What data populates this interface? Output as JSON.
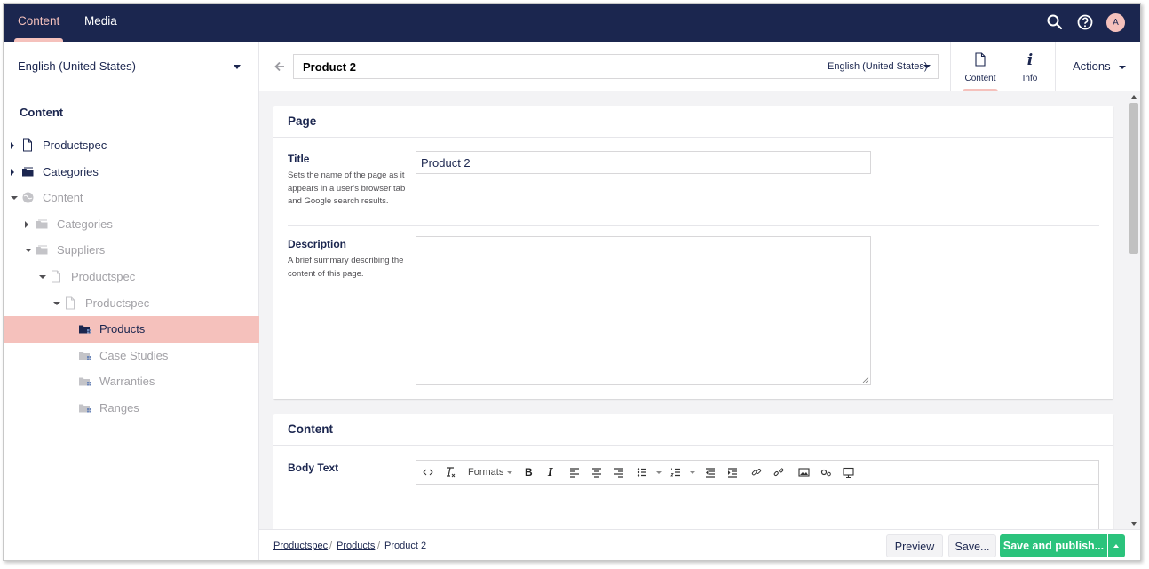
{
  "topbar": {
    "sections": [
      "Content",
      "Media"
    ],
    "active_section": "Content",
    "avatar_initial": "A",
    "icons": [
      "search-icon",
      "help-icon"
    ]
  },
  "sidebar": {
    "language": "English (United States)",
    "tree_title": "Content",
    "tree": [
      {
        "label": "Productspec",
        "toggle": "right",
        "icon": "document-icon",
        "dim": false,
        "selected": false
      },
      {
        "label": "Categories",
        "toggle": "right",
        "icon": "folder-icon",
        "dim": false,
        "selected": false
      },
      {
        "label": "Content",
        "toggle": "down",
        "icon": "globe-icon",
        "dim": true,
        "selected": false
      },
      {
        "label": "Categories",
        "toggle": "right",
        "icon": "folder-icon",
        "dim": true,
        "selected": false
      },
      {
        "label": "Suppliers",
        "toggle": "down",
        "icon": "folder-icon",
        "dim": true,
        "selected": false
      },
      {
        "label": "Productspec",
        "toggle": "down",
        "icon": "document-icon",
        "dim": true,
        "selected": false
      },
      {
        "label": "Productspec",
        "toggle": "down",
        "icon": "document-icon",
        "dim": true,
        "selected": false
      },
      {
        "label": "Products",
        "toggle": "none",
        "icon": "folder-grid-icon",
        "dim": false,
        "selected": true
      },
      {
        "label": "Case Studies",
        "toggle": "none",
        "icon": "folder-grid-icon",
        "dim": true,
        "selected": false
      },
      {
        "label": "Warranties",
        "toggle": "none",
        "icon": "folder-grid-icon",
        "dim": true,
        "selected": false
      },
      {
        "label": "Ranges",
        "toggle": "none",
        "icon": "folder-grid-icon",
        "dim": true,
        "selected": false
      }
    ]
  },
  "editor": {
    "node_name": "Product 2",
    "variant": "English (United States)",
    "apps": [
      {
        "label": "Content",
        "icon": "document-icon",
        "active": true
      },
      {
        "label": "Info",
        "icon": "info-icon",
        "active": false
      }
    ],
    "actions_label": "Actions"
  },
  "page_group": {
    "title": "Page",
    "title_prop": {
      "label": "Title",
      "description": "Sets the name of the page as it appears in a user's browser tab and Google search results.",
      "value": "Product 2"
    },
    "description_prop": {
      "label": "Description",
      "description": "A brief summary describing the content of this page.",
      "value": ""
    }
  },
  "content_group": {
    "title": "Content",
    "body_text_label": "Body Text",
    "toolbar": {
      "formats_label": "Formats",
      "buttons": [
        "source-code-icon",
        "clear-format-icon",
        "bold-icon",
        "italic-icon",
        "align-left-icon",
        "align-center-icon",
        "align-right-icon",
        "bullet-list-icon",
        "numbered-list-icon",
        "outdent-icon",
        "indent-icon",
        "link-icon",
        "unlink-icon",
        "image-icon",
        "macro-icon",
        "embed-icon"
      ]
    }
  },
  "footer": {
    "breadcrumb": [
      "Productspec",
      "Products",
      "Product 2"
    ],
    "preview_label": "Preview",
    "save_label": "Save...",
    "publish_label": "Save and publish...",
    "colors": {
      "publish": "#2bc37c",
      "brand": "#1b264f",
      "accent": "#f5c1bc"
    }
  }
}
